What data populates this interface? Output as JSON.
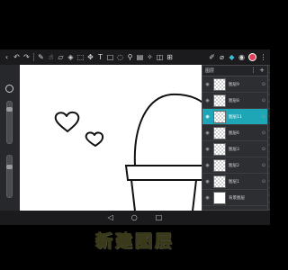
{
  "toolbar": {
    "icons": [
      "back-icon",
      "undo-icon",
      "redo-icon",
      "brush-icon",
      "smudge-icon",
      "eraser-icon",
      "fill-icon",
      "select-icon",
      "transform-icon",
      "text-icon",
      "shape-icon",
      "lasso-icon",
      "wand-icon",
      "gradient-icon",
      "filter-icon",
      "ruler-icon",
      "perspective-icon",
      "pen-icon",
      "eyedropper-icon",
      "layers-icon",
      "brush-settings-icon",
      "color-icon",
      "more-icon"
    ],
    "active_icon": "layers-icon",
    "brush_color": "#e0405a"
  },
  "layers_panel": {
    "title": "图层",
    "add_label": "+",
    "layers": [
      {
        "name": "图层9",
        "selected": false
      },
      {
        "name": "图层8",
        "selected": false
      },
      {
        "name": "图层11",
        "selected": true
      },
      {
        "name": "图层6",
        "selected": false
      },
      {
        "name": "图层3",
        "selected": false
      },
      {
        "name": "图层2",
        "selected": false
      },
      {
        "name": "图层1",
        "selected": false
      },
      {
        "name": "背景图层",
        "selected": false
      }
    ],
    "accent_color": "#1fa6b6"
  },
  "caption": {
    "text": "新建图层"
  }
}
